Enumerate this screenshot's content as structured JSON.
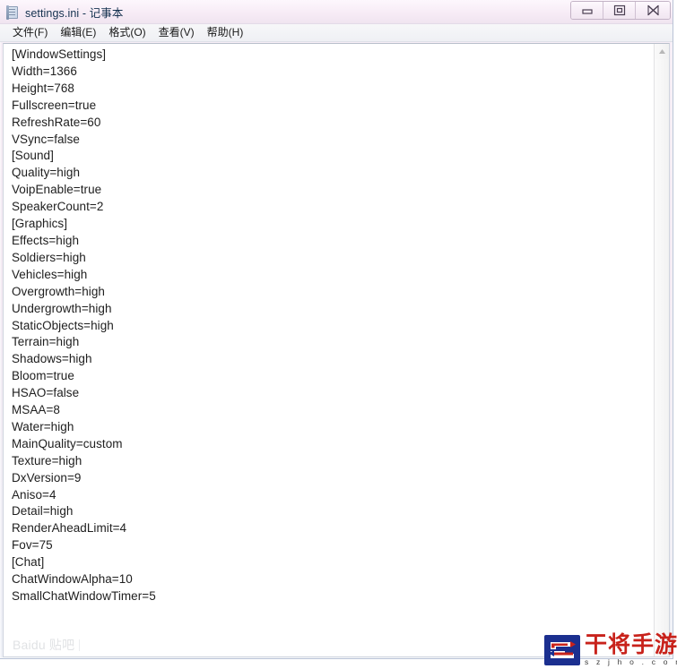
{
  "window": {
    "title": "settings.ini - 记事本",
    "icon": "notepad-icon",
    "buttons": {
      "minimize": "最小化",
      "maximize": "最大化",
      "close": "关闭"
    }
  },
  "menubar": {
    "items": [
      {
        "label": "文件(F)"
      },
      {
        "label": "编辑(E)"
      },
      {
        "label": "格式(O)"
      },
      {
        "label": "查看(V)"
      },
      {
        "label": "帮助(H)"
      }
    ]
  },
  "editor": {
    "lines": [
      "[WindowSettings]",
      "Width=1366",
      "Height=768",
      "Fullscreen=true",
      "RefreshRate=60",
      "VSync=false",
      "[Sound]",
      "Quality=high",
      "VoipEnable=true",
      "SpeakerCount=2",
      "[Graphics]",
      "Effects=high",
      "Soldiers=high",
      "Vehicles=high",
      "Overgrowth=high",
      "Undergrowth=high",
      "StaticObjects=high",
      "Terrain=high",
      "Shadows=high",
      "Bloom=true",
      "HSAO=false",
      "MSAA=8",
      "Water=high",
      "MainQuality=custom",
      "Texture=high",
      "DxVersion=9",
      "Aniso=4",
      "Detail=high",
      "RenderAheadLimit=4",
      "Fov=75",
      "[Chat]",
      "ChatWindowAlpha=10",
      "SmallChatWindowTimer=5"
    ]
  },
  "scrollbar": {
    "up_arrow": "scroll-up-icon",
    "down_arrow": "scroll-down-icon"
  },
  "watermarks": {
    "baidu": {
      "text": "Baidu 贴吧"
    },
    "site": {
      "name": "干将手游站",
      "url": "s z j h o . c o m"
    }
  },
  "colors": {
    "title_bar": "#f7ecf6",
    "text": "#202020",
    "logo_red": "#c8221b",
    "logo_blue": "#1b2f8f"
  }
}
